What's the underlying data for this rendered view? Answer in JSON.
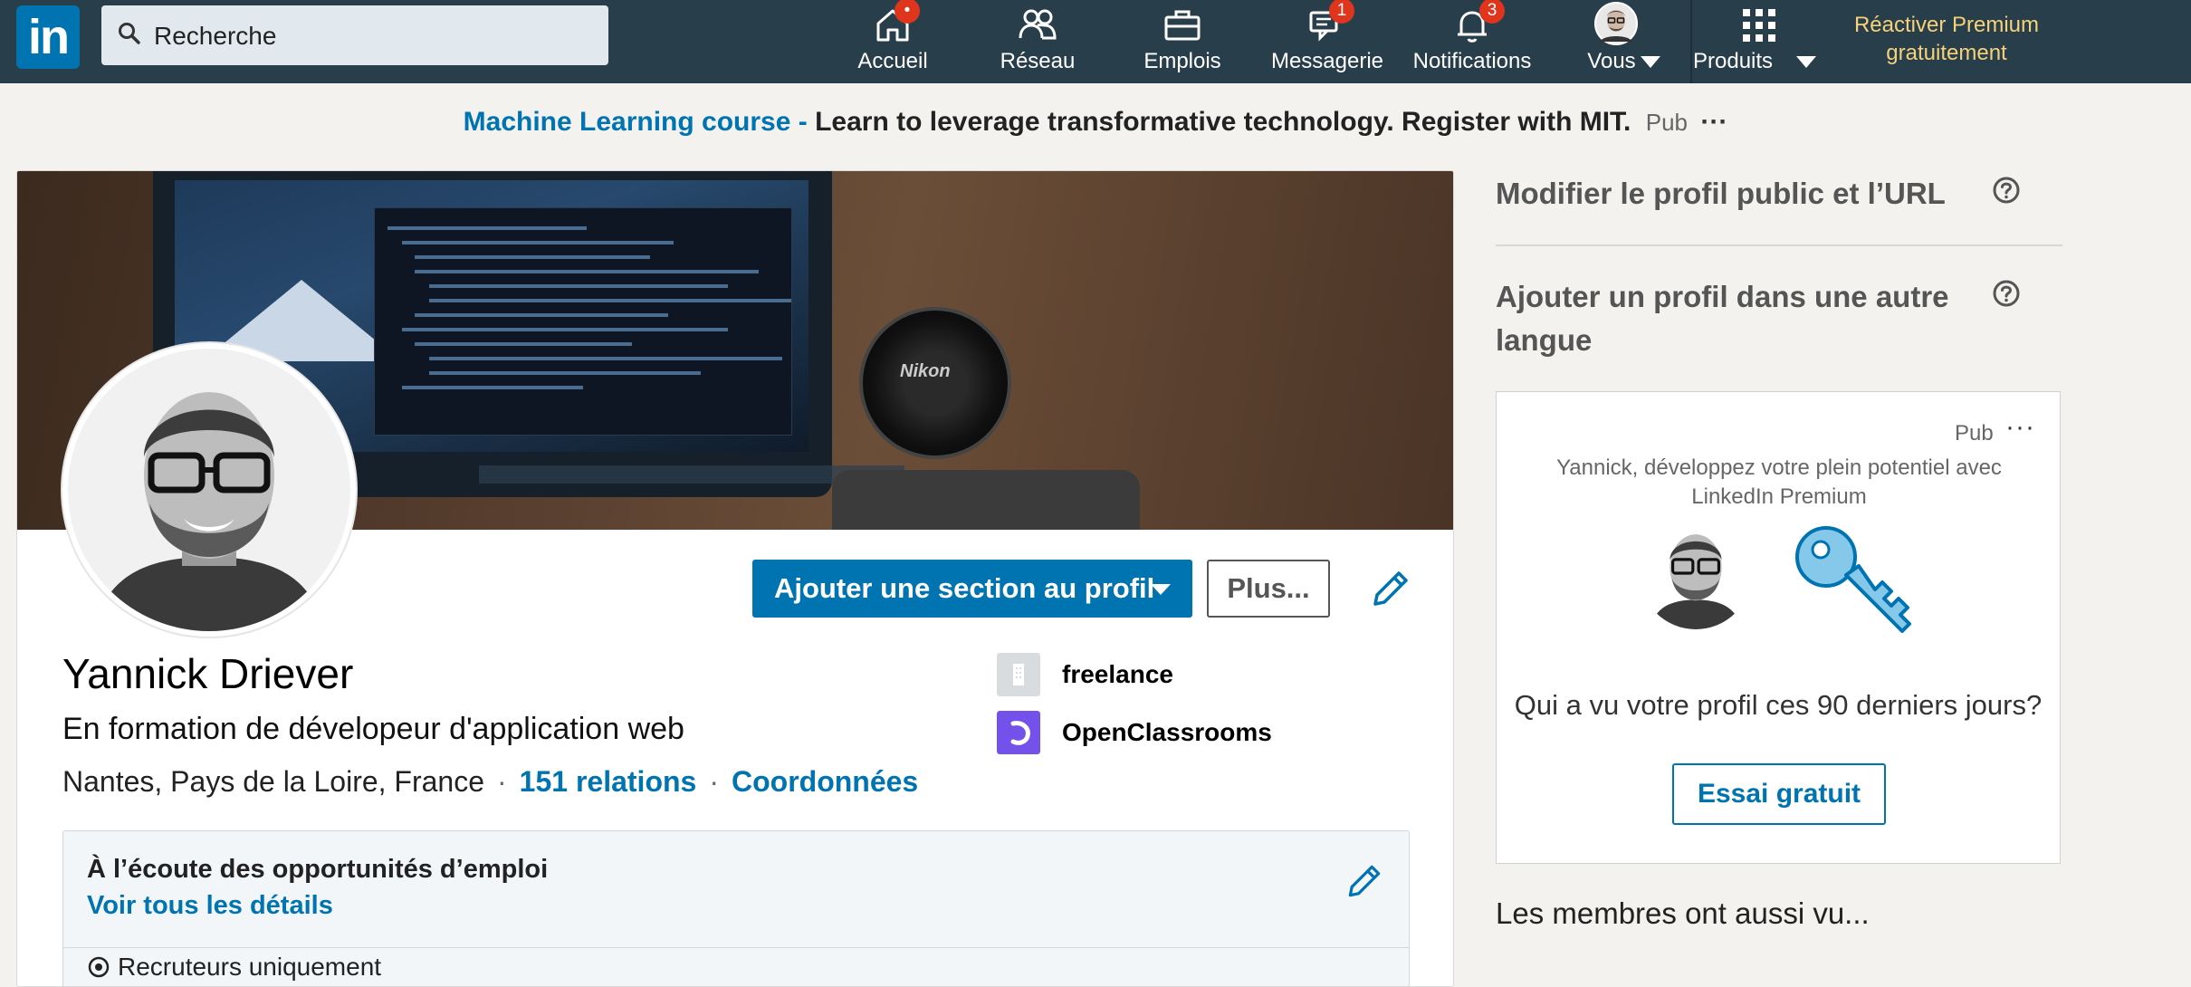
{
  "nav": {
    "search_placeholder": "Recherche",
    "items": [
      {
        "label": "Accueil",
        "icon": "home-icon",
        "badge": "•"
      },
      {
        "label": "Réseau",
        "icon": "network-icon",
        "badge": ""
      },
      {
        "label": "Emplois",
        "icon": "briefcase-icon",
        "badge": ""
      },
      {
        "label": "Messagerie",
        "icon": "messaging-icon",
        "badge": "1"
      },
      {
        "label": "Notifications",
        "icon": "bell-icon",
        "badge": "3"
      },
      {
        "label": "Vous",
        "icon": "avatar",
        "badge": ""
      },
      {
        "label": "Produits",
        "icon": "grid-icon",
        "badge": ""
      }
    ],
    "premium_line1": "Réactiver Premium",
    "premium_line2": "gratuitement",
    "colors": {
      "bar": "#283e4a",
      "brand": "#0073b1",
      "badge": "#e0351d",
      "premium": "#f5d27a"
    }
  },
  "ad": {
    "course": "Machine Learning course -",
    "text": "Learn to leverage transformative technology. Register with MIT.",
    "pub": "Pub",
    "more": "···"
  },
  "profile": {
    "add_section_label": "Ajouter une section au profil",
    "more_label": "Plus...",
    "name": "Yannick Driever",
    "headline": "En formation de dévelopeur d'application web",
    "location": "Nantes, Pays de la Loire, France",
    "connections": "151 relations",
    "contact": "Coordonnées",
    "separator": "·",
    "companies": [
      {
        "name": "freelance",
        "icon": "building-icon"
      },
      {
        "name": "OpenClassrooms",
        "icon": "openclassrooms-logo"
      }
    ],
    "open_to_work": {
      "title": "À l’écoute des opportunités d’emploi",
      "link": "Voir tous les détails",
      "sub": "Recruteurs uniquement"
    }
  },
  "sidebar": {
    "edit_public_profile": "Modifier le profil public et l’URL",
    "add_language_line1": "Ajouter un profil dans une autre",
    "add_language_line2": "langue",
    "premium_ad": {
      "pub": "Pub",
      "more": "···",
      "message_line1": "Yannick, développez votre plein potentiel avec",
      "message_line2": "LinkedIn Premium",
      "question": "Qui a vu votre profil ces 90 derniers jours?",
      "cta": "Essai gratuit"
    },
    "also_viewed": "Les membres ont aussi vu..."
  }
}
